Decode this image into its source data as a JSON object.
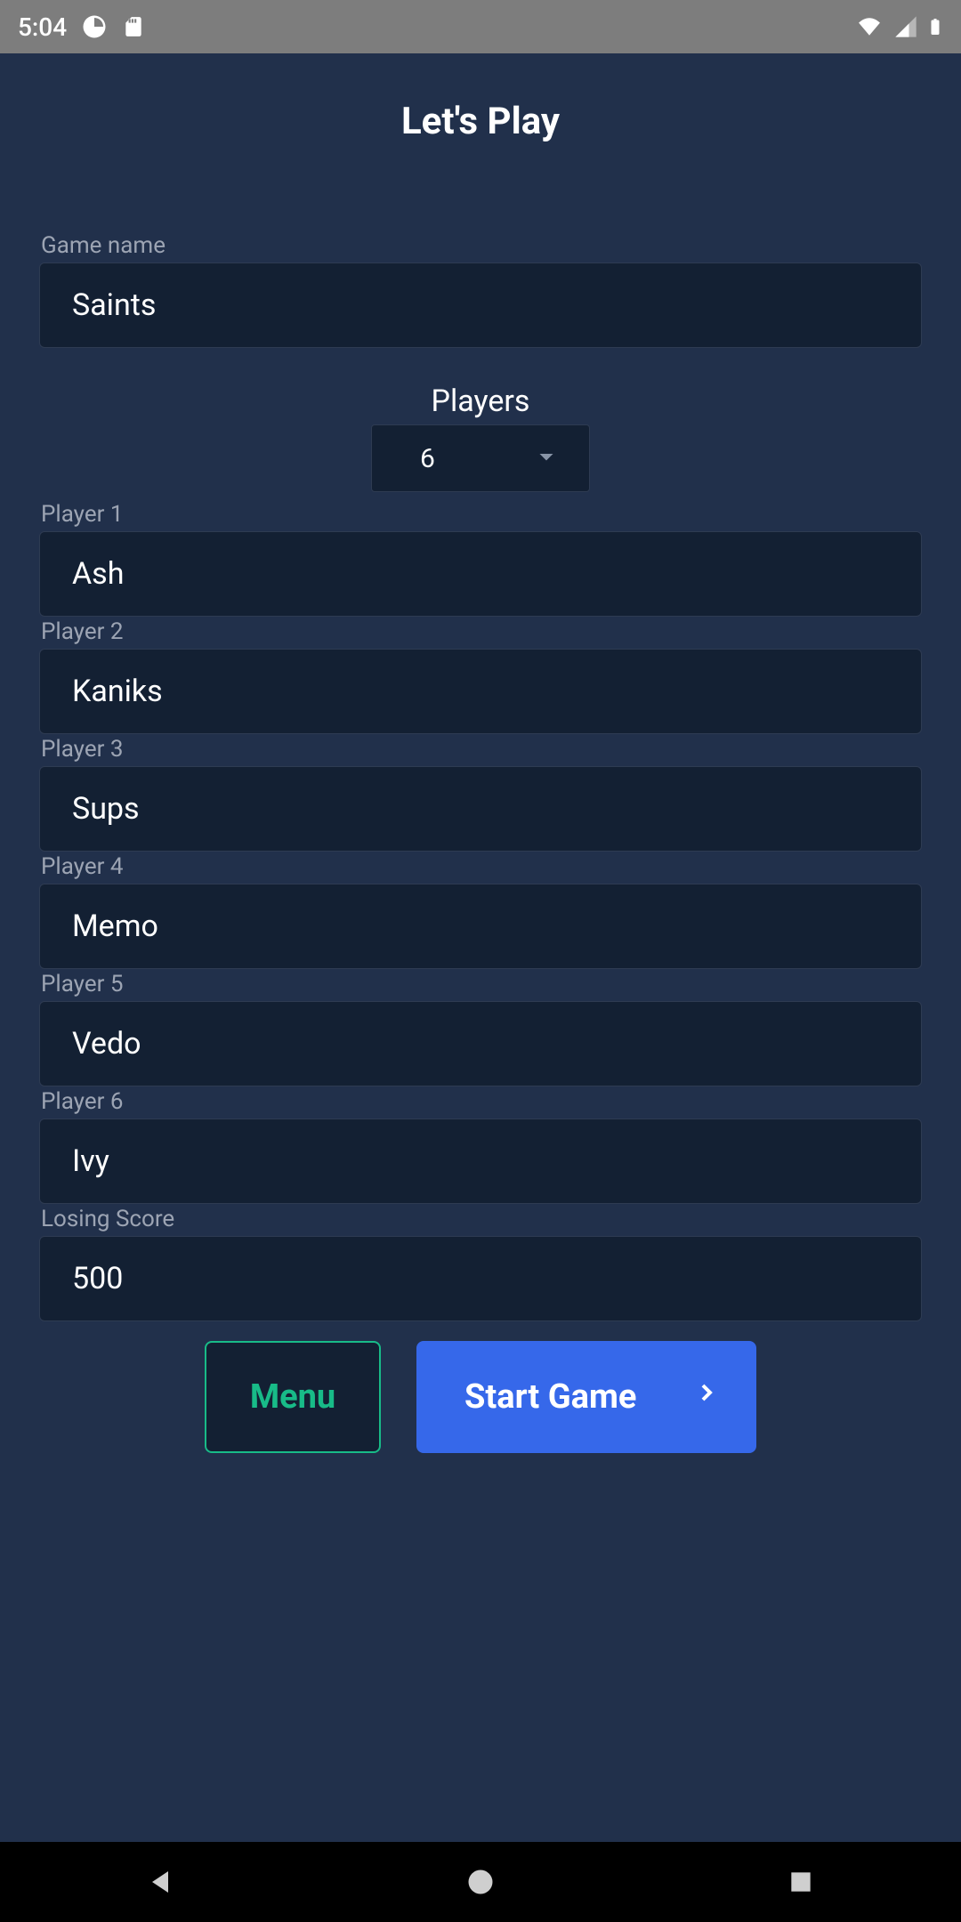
{
  "status": {
    "time": "5:04"
  },
  "title": "Let's Play",
  "gameName": {
    "label": "Game name",
    "value": "Saints"
  },
  "players": {
    "label": "Players",
    "count": "6"
  },
  "playerFields": [
    {
      "label": "Player 1",
      "value": "Ash"
    },
    {
      "label": "Player 2",
      "value": "Kaniks"
    },
    {
      "label": "Player 3",
      "value": "Sups"
    },
    {
      "label": "Player 4",
      "value": "Memo"
    },
    {
      "label": "Player 5",
      "value": "Vedo"
    },
    {
      "label": "Player 6",
      "value": "Ivy"
    }
  ],
  "losingScore": {
    "label": "Losing Score",
    "value": "500"
  },
  "buttons": {
    "menu": "Menu",
    "start": "Start Game"
  }
}
